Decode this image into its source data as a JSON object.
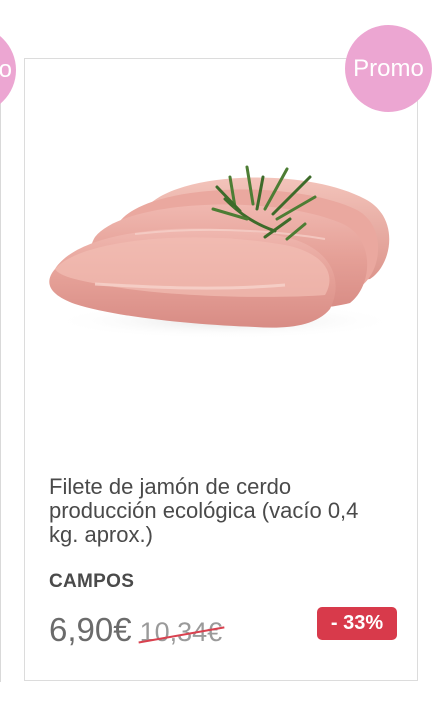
{
  "previous_card": {
    "badge_label": "Promo"
  },
  "product": {
    "badge_label": "Promo",
    "image_icon": "pork-fillet-image",
    "title": "Filete de jamón de cerdo producción ecológica (vacío 0,4 kg. aprox.)",
    "brand": "CAMPOS",
    "price": "6,90€",
    "old_price": "10,34€",
    "discount": "- 33%"
  },
  "colors": {
    "promo_badge": "#eca6d2",
    "discount_badge": "#d83a4b",
    "strike": "#d9414f",
    "text": "#4a4a4a"
  }
}
